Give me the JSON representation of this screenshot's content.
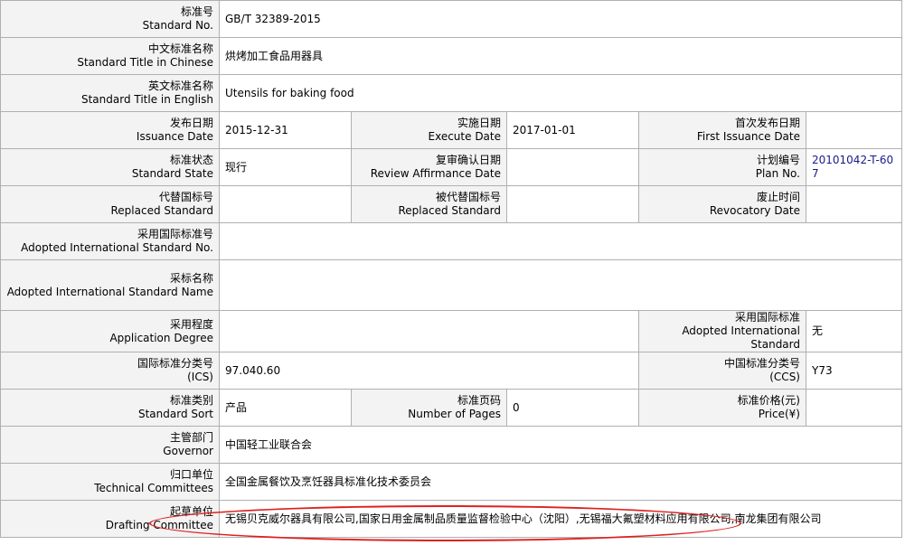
{
  "rows": {
    "standard_no": {
      "label_cn": "标准号",
      "label_en": "Standard No.",
      "value": "GB/T 32389-2015"
    },
    "title_cn": {
      "label_cn": "中文标准名称",
      "label_en": "Standard Title in Chinese",
      "value": "烘烤加工食品用器具"
    },
    "title_en": {
      "label_cn": "英文标准名称",
      "label_en": "Standard Title in English",
      "value": "Utensils for baking food"
    },
    "issuance_date": {
      "label_cn": "发布日期",
      "label_en": "Issuance Date",
      "value": "2015-12-31"
    },
    "execute_date": {
      "label_cn": "实施日期",
      "label_en": "Execute Date",
      "value": "2017-01-01"
    },
    "first_issuance_date": {
      "label_cn": "首次发布日期",
      "label_en": "First Issuance Date",
      "value": ""
    },
    "standard_state": {
      "label_cn": "标准状态",
      "label_en": "Standard State",
      "value": "现行"
    },
    "review_affirmance_date": {
      "label_cn": "复审确认日期",
      "label_en": "Review Affirmance Date",
      "value": ""
    },
    "plan_no": {
      "label_cn": "计划编号",
      "label_en": "Plan No.",
      "value": "20101042-T-607"
    },
    "replaced_standard": {
      "label_cn": "代替国标号",
      "label_en": "Replaced Standard",
      "value": ""
    },
    "replaced_by_standard": {
      "label_cn": "被代替国标号",
      "label_en": "Replaced Standard",
      "value": ""
    },
    "revocatory_date": {
      "label_cn": "废止时间",
      "label_en": "Revocatory Date",
      "value": ""
    },
    "adopted_intl_no": {
      "label_cn": "采用国际标准号",
      "label_en": "Adopted International Standard No.",
      "value": ""
    },
    "adopted_intl_name": {
      "label_cn": "采标名称",
      "label_en": "Adopted International Standard Name",
      "value": ""
    },
    "application_degree": {
      "label_cn": "采用程度",
      "label_en": "Application Degree",
      "value": ""
    },
    "adopted_intl_standard": {
      "label_cn": "采用国际标准",
      "label_en": "Adopted International Standard",
      "value": "无"
    },
    "ics": {
      "label_cn": "国际标准分类号",
      "label_en": "(ICS)",
      "value": "97.040.60"
    },
    "ccs": {
      "label_cn": "中国标准分类号",
      "label_en": "(CCS)",
      "value": "Y73"
    },
    "standard_sort": {
      "label_cn": "标准类别",
      "label_en": "Standard Sort",
      "value": "产品"
    },
    "number_of_pages": {
      "label_cn": "标准页码",
      "label_en": "Number of Pages",
      "value": "0"
    },
    "price": {
      "label_cn": "标准价格(元)",
      "label_en": "Price(¥)",
      "value": ""
    },
    "governor": {
      "label_cn": "主管部门",
      "label_en": "Governor",
      "value": "中国轻工业联合会"
    },
    "technical_committees": {
      "label_cn": "归口单位",
      "label_en": "Technical Committees",
      "value": "全国金属餐饮及烹饪器具标准化技术委员会"
    },
    "drafting_committee": {
      "label_cn": "起草单位",
      "label_en": "Drafting Committee",
      "value": "无锡贝克威尔器具有限公司,国家日用金属制品质量监督检验中心（沈阳）,无锡福大氟塑材料应用有限公司,南龙集团有限公司"
    }
  },
  "colors": {
    "label_bg": "#f3f3f3",
    "border": "#b0b0b0",
    "highlight": "#e02020",
    "link": "#1a1a8c"
  }
}
